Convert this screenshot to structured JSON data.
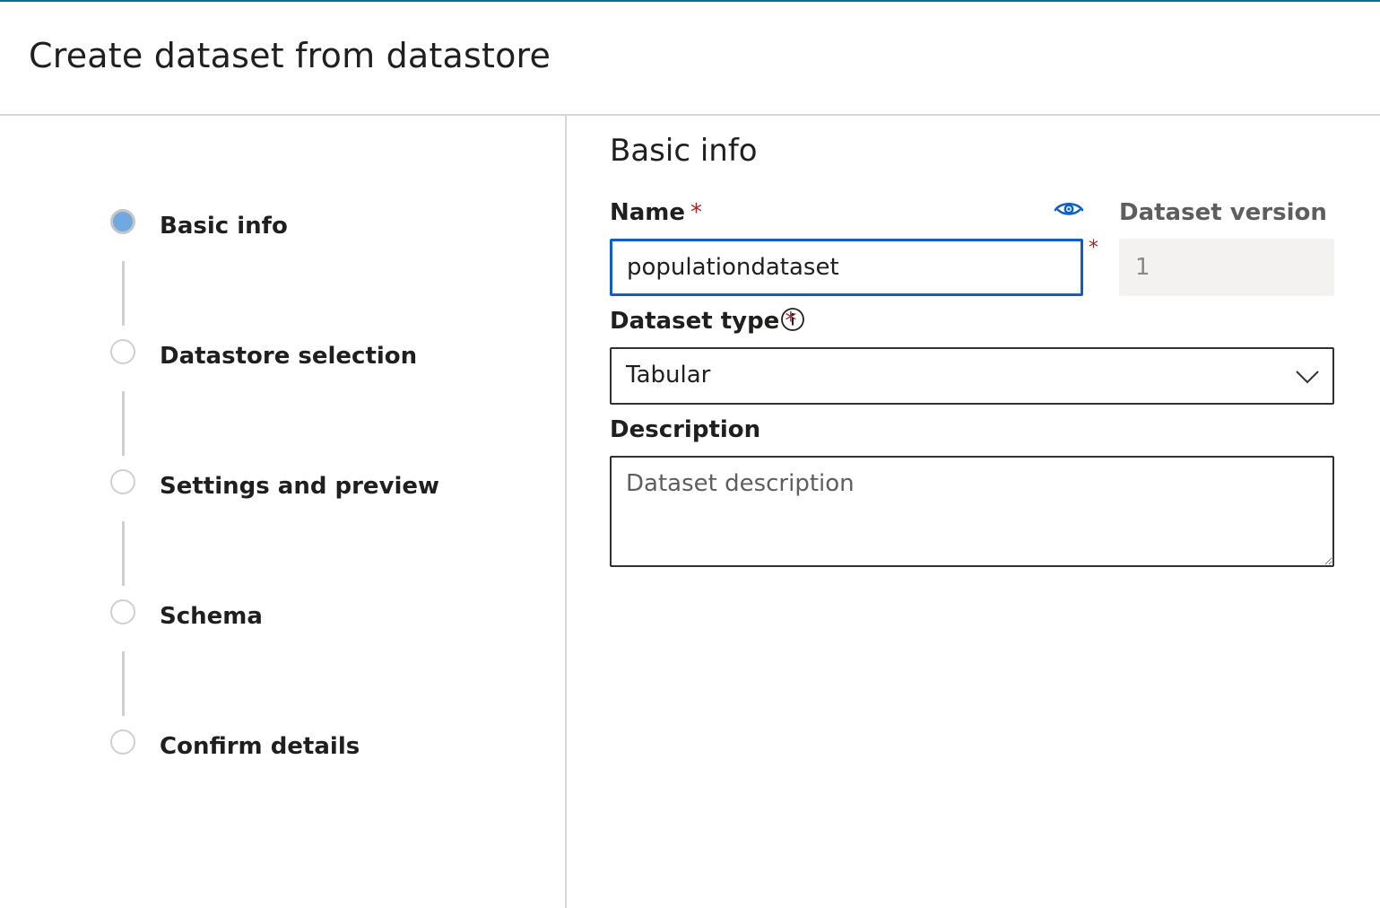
{
  "header": {
    "title": "Create dataset from datastore"
  },
  "stepper": {
    "steps": [
      {
        "label": "Basic info",
        "active": true
      },
      {
        "label": "Datastore selection",
        "active": false
      },
      {
        "label": "Settings and preview",
        "active": false
      },
      {
        "label": "Schema",
        "active": false
      },
      {
        "label": "Confirm details",
        "active": false
      }
    ]
  },
  "form": {
    "title": "Basic info",
    "name": {
      "label": "Name",
      "required_mark": "*",
      "value": "populationdataset"
    },
    "visibility_icon": "eye-icon",
    "version": {
      "label": "Dataset version",
      "value": "1"
    },
    "dataset_type": {
      "label": "Dataset type",
      "required_mark": "*",
      "info_icon": "info-icon",
      "selected": "Tabular"
    },
    "description": {
      "label": "Description",
      "placeholder": "Dataset description",
      "value": ""
    }
  },
  "colors": {
    "accent": "#0f5fc2",
    "active_step": "#6fa9e0",
    "required": "#a4262c",
    "top_bar": "#0f6e8a"
  }
}
